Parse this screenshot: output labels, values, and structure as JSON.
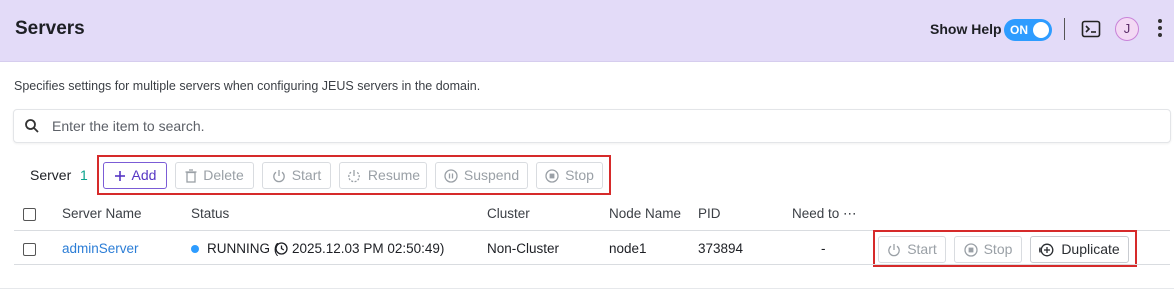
{
  "header": {
    "title": "Servers",
    "show_help_label": "Show Help",
    "toggle_label": "ON",
    "avatar_initial": "J",
    "accent_color": "#e3dbf8"
  },
  "description": "Specifies settings for multiple servers when configuring JEUS servers in the domain.",
  "search": {
    "placeholder": "Enter the item to search.",
    "value": ""
  },
  "toolbar": {
    "section_label": "Server",
    "count": "1",
    "add_label": "Add",
    "delete_label": "Delete",
    "start_label": "Start",
    "resume_label": "Resume",
    "suspend_label": "Suspend",
    "stop_label": "Stop"
  },
  "table": {
    "columns": [
      "Server Name",
      "Status",
      "Cluster",
      "Node Name",
      "PID",
      "Need to ⋯"
    ],
    "rows": [
      {
        "server_name": "adminServer",
        "status": "RUNNING (",
        "status_time": "2025.12.03 PM 02:50:49)",
        "cluster": "Non-Cluster",
        "node_name": "node1",
        "pid": "373894",
        "need_to": "-",
        "actions": {
          "start_label": "Start",
          "stop_label": "Stop",
          "duplicate_label": "Duplicate"
        }
      }
    ]
  },
  "colors": {
    "highlight_frame": "#d62a2a",
    "status_running": "#2d9cff",
    "count": "#0aa38c",
    "link": "#2b7dd6"
  },
  "icons": [
    "terminal-icon",
    "kebab-menu-icon",
    "search-icon",
    "plus-icon",
    "trash-icon",
    "power-icon",
    "resume-icon",
    "pause-icon",
    "stop-icon",
    "clock-icon",
    "plus-circle-icon"
  ]
}
